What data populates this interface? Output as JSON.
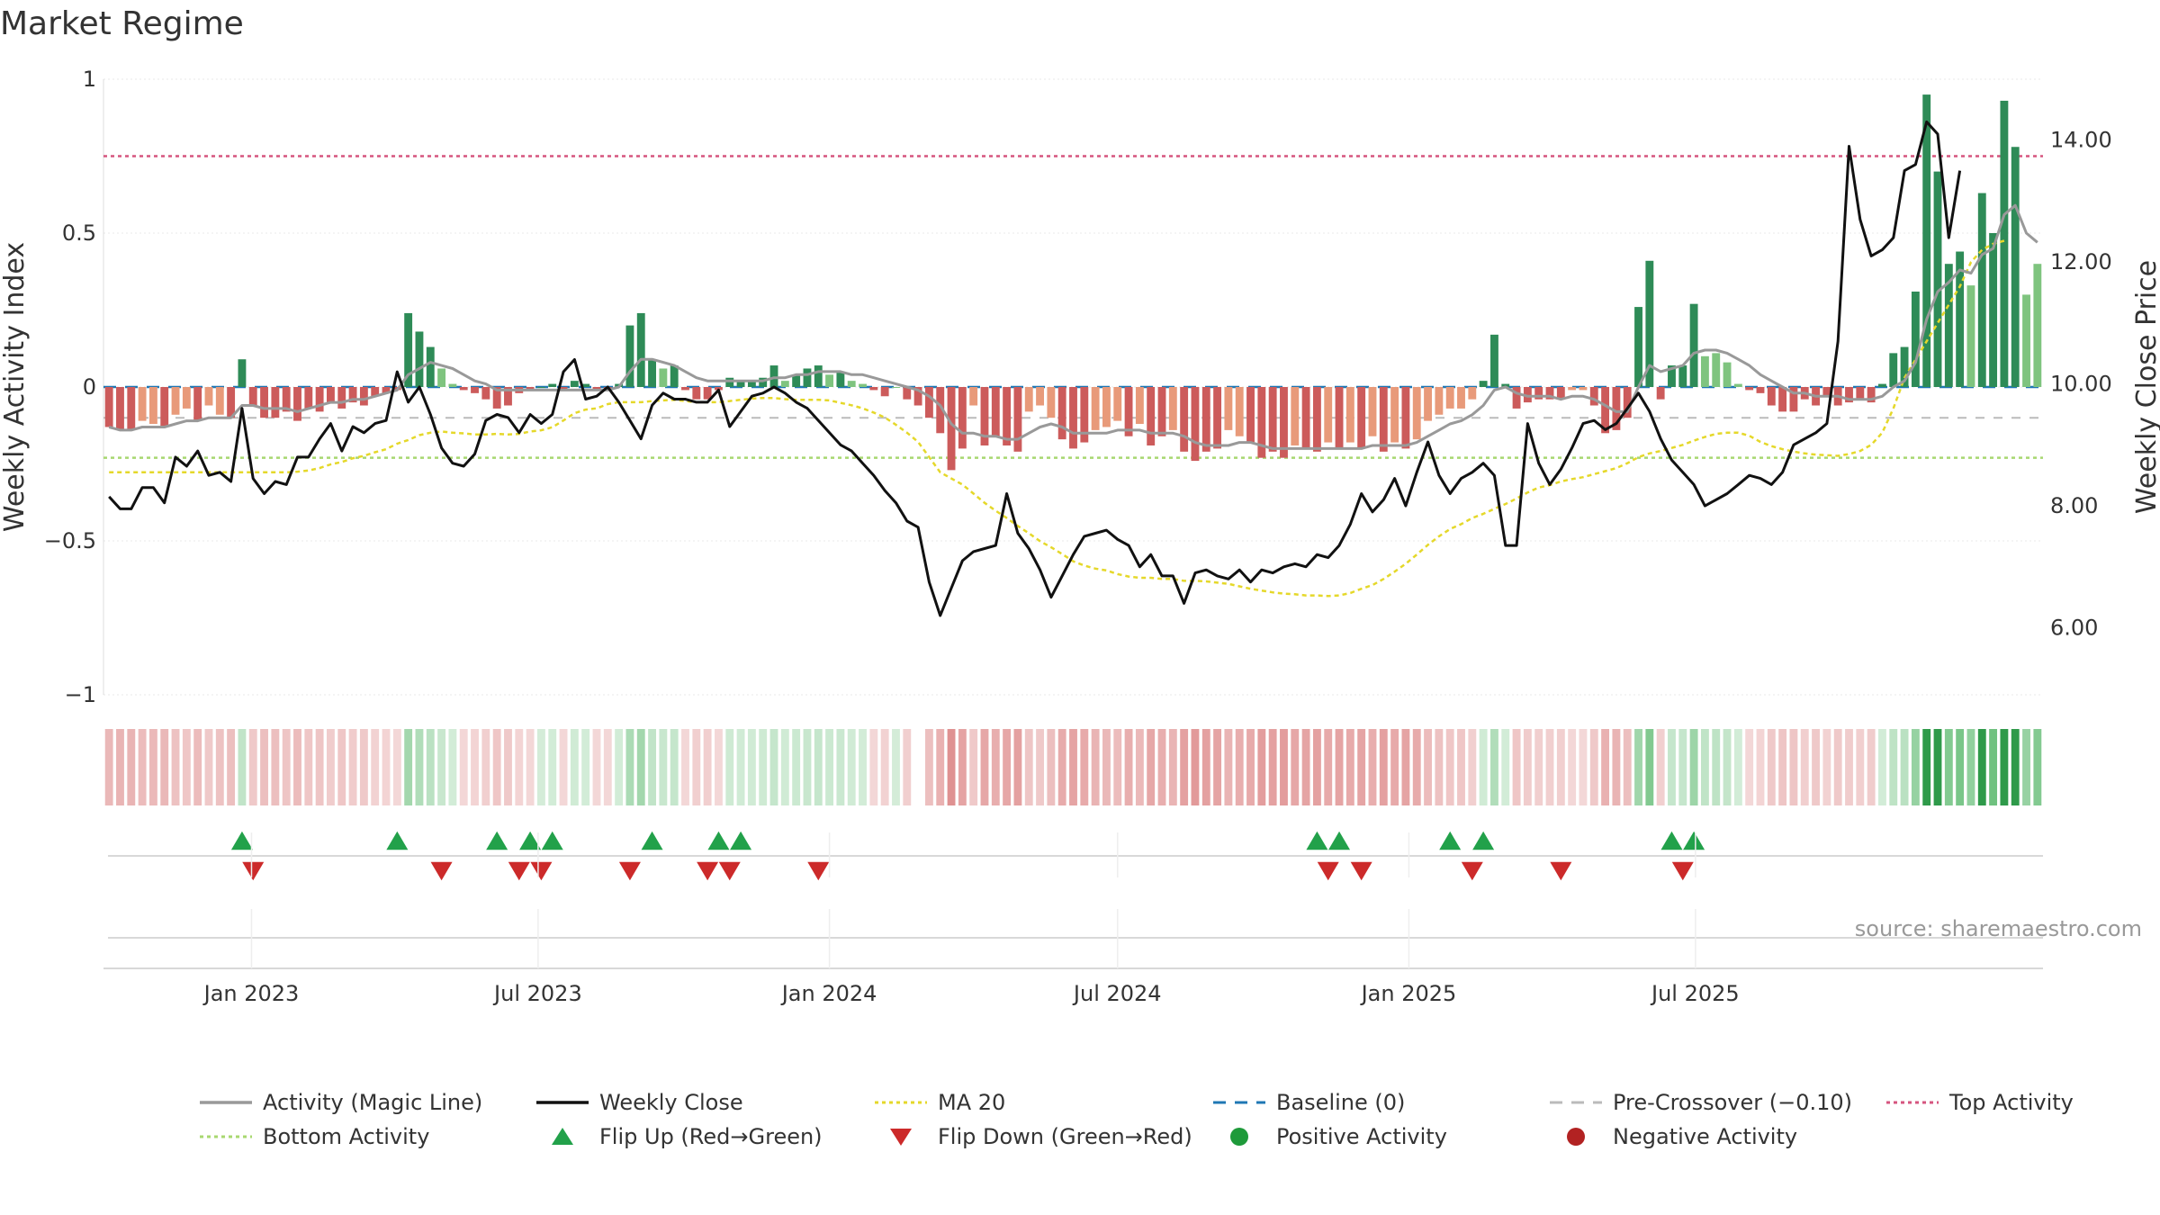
{
  "colors": {
    "bar_neg_strong": "#cc5b5b",
    "bar_neg_weak": "#e89a7a",
    "bar_pos_strong": "#2e8b57",
    "bar_pos_weak": "#7fc47f",
    "magic": "#999999",
    "close": "#111111",
    "ma20": "#e5d82a",
    "baseline": "#1f77b4",
    "precross": "#bbbbbb",
    "top": "#d6557f",
    "bottom": "#a8d870",
    "flip_up": "#22a14a",
    "flip_down": "#cc2a2a",
    "pos_dot": "#1e9a3a",
    "neg_dot": "#b22222"
  },
  "chart_data": {
    "type": "bar+line",
    "title": "Market Regime",
    "ylabel_left": "Weekly Activity Index",
    "ylabel_right": "Weekly Close Price",
    "y_left_ticks": [
      {
        "v": 1,
        "label": "1"
      },
      {
        "v": 0.5,
        "label": "0.5"
      },
      {
        "v": 0,
        "label": "0"
      },
      {
        "v": -0.5,
        "label": "−0.5"
      },
      {
        "v": -1,
        "label": "−1"
      }
    ],
    "y_left_range": [
      -1.0,
      1.0
    ],
    "y_right_ticks": [
      {
        "v": 14,
        "label": "14.00"
      },
      {
        "v": 12,
        "label": "12.00"
      },
      {
        "v": 10,
        "label": "10.00"
      },
      {
        "v": 8,
        "label": "8.00"
      },
      {
        "v": 6,
        "label": "6.00"
      }
    ],
    "y_right_range": [
      4.9,
      15.0
    ],
    "x_ticks": [
      "Jan 2023",
      "Jul 2023",
      "Jan 2024",
      "Jul 2024",
      "Jan 2025",
      "Jul 2025"
    ],
    "start_date": "2022-10-03",
    "reference_lines": {
      "baseline": 0,
      "precross": -0.1,
      "top": 0.75,
      "bottom": -0.23
    },
    "activity": [
      -0.13,
      -0.14,
      -0.14,
      -0.11,
      -0.12,
      -0.13,
      -0.09,
      -0.07,
      -0.11,
      -0.06,
      -0.09,
      -0.1,
      0.09,
      -0.06,
      -0.1,
      -0.1,
      -0.08,
      -0.11,
      -0.07,
      -0.08,
      -0.05,
      -0.07,
      -0.05,
      -0.06,
      -0.03,
      -0.02,
      -0.01,
      0.24,
      0.18,
      0.13,
      0.06,
      0.01,
      -0.01,
      -0.02,
      -0.04,
      -0.07,
      -0.06,
      -0.02,
      -0.01,
      0,
      0.01,
      -0.01,
      0.02,
      0.01,
      -0.01,
      -0.01,
      0.01,
      0.2,
      0.24,
      0.09,
      0.06,
      0.07,
      -0.01,
      -0.04,
      -0.04,
      -0.01,
      0.03,
      0.02,
      0.02,
      0.03,
      0.07,
      0.02,
      0.04,
      0.06,
      0.07,
      0.04,
      0.05,
      0.02,
      0.01,
      -0.01,
      -0.03,
      0,
      -0.04,
      -0.06,
      -0.1,
      -0.15,
      -0.27,
      -0.2,
      -0.06,
      -0.19,
      -0.16,
      -0.19,
      -0.21,
      -0.08,
      -0.06,
      -0.1,
      -0.17,
      -0.2,
      -0.18,
      -0.14,
      -0.13,
      -0.11,
      -0.16,
      -0.12,
      -0.19,
      -0.16,
      -0.14,
      -0.21,
      -0.24,
      -0.21,
      -0.2,
      -0.14,
      -0.16,
      -0.18,
      -0.23,
      -0.21,
      -0.23,
      -0.19,
      -0.2,
      -0.21,
      -0.18,
      -0.2,
      -0.18,
      -0.2,
      -0.16,
      -0.21,
      -0.18,
      -0.2,
      -0.17,
      -0.11,
      -0.09,
      -0.07,
      -0.07,
      -0.04,
      0.02,
      0.17,
      0.01,
      -0.07,
      -0.05,
      -0.04,
      -0.04,
      -0.04,
      -0.01,
      -0.01,
      -0.06,
      -0.15,
      -0.14,
      -0.1,
      0.26,
      0.41,
      -0.04,
      0.07,
      0.07,
      0.27,
      0.1,
      0.11,
      0.08,
      0.01,
      -0.01,
      -0.02,
      -0.06,
      -0.08,
      -0.08,
      -0.04,
      -0.06,
      -0.03,
      -0.06,
      -0.05,
      -0.04,
      -0.05,
      0.01,
      0.11,
      0.13,
      0.31,
      0.95,
      0.7,
      0.4,
      0.44,
      0.33,
      0.63,
      0.5,
      0.93,
      0.78,
      0.3,
      0.4
    ],
    "magic_line": [
      -0.13,
      -0.14,
      -0.14,
      -0.13,
      -0.13,
      -0.13,
      -0.12,
      -0.11,
      -0.11,
      -0.1,
      -0.1,
      -0.1,
      -0.06,
      -0.06,
      -0.07,
      -0.07,
      -0.07,
      -0.08,
      -0.07,
      -0.06,
      -0.05,
      -0.05,
      -0.04,
      -0.04,
      -0.03,
      -0.02,
      -0.01,
      0.04,
      0.06,
      0.08,
      0.07,
      0.06,
      0.04,
      0.02,
      0.01,
      -0.01,
      -0.01,
      -0.01,
      -0.01,
      -0.01,
      -0.01,
      -0.01,
      -0.01,
      -0.01,
      -0.01,
      -0.01,
      0,
      0.05,
      0.09,
      0.09,
      0.08,
      0.07,
      0.05,
      0.03,
      0.02,
      0.02,
      0.02,
      0.02,
      0.02,
      0.02,
      0.03,
      0.03,
      0.04,
      0.04,
      0.05,
      0.05,
      0.05,
      0.04,
      0.04,
      0.03,
      0.02,
      0.01,
      0,
      -0.01,
      -0.03,
      -0.06,
      -0.12,
      -0.15,
      -0.15,
      -0.16,
      -0.16,
      -0.17,
      -0.17,
      -0.15,
      -0.13,
      -0.12,
      -0.13,
      -0.15,
      -0.15,
      -0.15,
      -0.15,
      -0.14,
      -0.14,
      -0.14,
      -0.15,
      -0.15,
      -0.15,
      -0.16,
      -0.18,
      -0.19,
      -0.19,
      -0.19,
      -0.18,
      -0.18,
      -0.19,
      -0.2,
      -0.2,
      -0.2,
      -0.2,
      -0.2,
      -0.2,
      -0.2,
      -0.2,
      -0.2,
      -0.19,
      -0.19,
      -0.19,
      -0.19,
      -0.18,
      -0.16,
      -0.14,
      -0.12,
      -0.11,
      -0.09,
      -0.06,
      -0.01,
      0,
      -0.02,
      -0.03,
      -0.03,
      -0.03,
      -0.04,
      -0.03,
      -0.03,
      -0.04,
      -0.06,
      -0.08,
      -0.08,
      0,
      0.07,
      0.05,
      0.06,
      0.07,
      0.11,
      0.12,
      0.12,
      0.11,
      0.09,
      0.07,
      0.04,
      0.02,
      0,
      -0.02,
      -0.02,
      -0.03,
      -0.03,
      -0.03,
      -0.04,
      -0.04,
      -0.04,
      -0.03,
      0,
      0.02,
      0.08,
      0.22,
      0.31,
      0.34,
      0.38,
      0.37,
      0.43,
      0.45,
      0.56,
      0.59,
      0.5,
      0.47
    ],
    "weekly_close": [
      8.15,
      7.95,
      7.95,
      8.3,
      8.3,
      8.05,
      8.8,
      8.65,
      8.9,
      8.5,
      8.55,
      8.4,
      9.6,
      8.45,
      8.2,
      8.4,
      8.35,
      8.8,
      8.8,
      9.1,
      9.35,
      8.9,
      9.3,
      9.2,
      9.35,
      9.4,
      10.2,
      9.7,
      9.95,
      9.5,
      8.95,
      8.7,
      8.65,
      8.85,
      9.4,
      9.5,
      9.45,
      9.2,
      9.5,
      9.35,
      9.5,
      10.2,
      10.4,
      9.75,
      9.8,
      9.95,
      9.7,
      9.4,
      9.1,
      9.65,
      9.85,
      9.75,
      9.75,
      9.7,
      9.7,
      9.9,
      9.3,
      9.55,
      9.8,
      9.85,
      9.95,
      9.85,
      9.7,
      9.6,
      9.4,
      9.2,
      9.0,
      8.9,
      8.7,
      8.5,
      8.25,
      8.05,
      7.75,
      7.65,
      6.75,
      6.2,
      6.65,
      7.1,
      7.25,
      7.3,
      7.35,
      8.2,
      7.55,
      7.3,
      6.95,
      6.5,
      6.85,
      7.2,
      7.5,
      7.55,
      7.6,
      7.45,
      7.35,
      7.0,
      7.2,
      6.85,
      6.85,
      6.4,
      6.9,
      6.95,
      6.85,
      6.8,
      6.95,
      6.75,
      6.95,
      6.9,
      7.0,
      7.05,
      7.0,
      7.2,
      7.15,
      7.35,
      7.7,
      8.2,
      7.9,
      8.1,
      8.45,
      8.0,
      8.55,
      9.05,
      8.5,
      8.2,
      8.45,
      8.55,
      8.7,
      8.5,
      7.35,
      7.35,
      9.35,
      8.7,
      8.35,
      8.6,
      8.95,
      9.35,
      9.4,
      9.25,
      9.35,
      9.6,
      9.85,
      9.55,
      9.1,
      8.75,
      8.55,
      8.35,
      8.0,
      8.1,
      8.2,
      8.35,
      8.5,
      8.45,
      8.35,
      8.55,
      9.0,
      9.1,
      9.2,
      9.35,
      10.7,
      13.9,
      12.7,
      12.1,
      12.2,
      12.4,
      13.5,
      13.6,
      14.3,
      14.1,
      12.4,
      13.5
    ],
    "ma20": [
      8.55,
      8.55,
      8.55,
      8.55,
      8.55,
      8.55,
      8.55,
      8.55,
      8.55,
      8.55,
      8.55,
      8.55,
      8.55,
      8.55,
      8.55,
      8.55,
      8.55,
      8.56,
      8.58,
      8.62,
      8.68,
      8.72,
      8.78,
      8.82,
      8.88,
      8.93,
      9.02,
      9.08,
      9.16,
      9.2,
      9.22,
      9.2,
      9.19,
      9.17,
      9.17,
      9.18,
      9.17,
      9.18,
      9.22,
      9.24,
      9.29,
      9.4,
      9.52,
      9.58,
      9.6,
      9.67,
      9.7,
      9.7,
      9.7,
      9.72,
      9.73,
      9.74,
      9.72,
      9.7,
      9.7,
      9.7,
      9.72,
      9.74,
      9.76,
      9.77,
      9.77,
      9.75,
      9.74,
      9.74,
      9.74,
      9.73,
      9.69,
      9.65,
      9.6,
      9.53,
      9.45,
      9.33,
      9.2,
      9.05,
      8.8,
      8.55,
      8.45,
      8.35,
      8.2,
      8.05,
      7.92,
      7.8,
      7.67,
      7.55,
      7.42,
      7.32,
      7.21,
      7.09,
      7.02,
      6.97,
      6.94,
      6.88,
      6.84,
      6.82,
      6.82,
      6.8,
      6.8,
      6.77,
      6.77,
      6.76,
      6.74,
      6.72,
      6.68,
      6.64,
      6.61,
      6.58,
      6.56,
      6.55,
      6.53,
      6.53,
      6.52,
      6.53,
      6.57,
      6.64,
      6.7,
      6.8,
      6.92,
      7.05,
      7.2,
      7.36,
      7.5,
      7.62,
      7.7,
      7.8,
      7.87,
      7.95,
      8.03,
      8.12,
      8.22,
      8.3,
      8.34,
      8.4,
      8.44,
      8.47,
      8.52,
      8.57,
      8.62,
      8.7,
      8.8,
      8.86,
      8.9,
      8.95,
      9.0,
      9.07,
      9.13,
      9.18,
      9.2,
      9.2,
      9.15,
      9.05,
      8.98,
      8.93,
      8.89,
      8.86,
      8.84,
      8.83,
      8.82,
      8.85,
      8.9,
      9.0,
      9.2,
      9.6,
      10.1,
      10.4,
      10.7,
      11.0,
      11.3,
      11.6,
      12.0,
      12.2,
      12.3,
      12.35
    ],
    "regime_strip_gap_week": 73,
    "flip_up_weeks": [
      12,
      26,
      35,
      38,
      40,
      49,
      55,
      57,
      109,
      111,
      121,
      124,
      141,
      143
    ],
    "flip_down_weeks": [
      13,
      30,
      37,
      39,
      47,
      54,
      56,
      64,
      110,
      113,
      123,
      131,
      142
    ],
    "source": "source: sharemaestro.com"
  },
  "legend": [
    {
      "key": "magic",
      "label": "Activity (Magic Line)",
      "style": "line"
    },
    {
      "key": "close",
      "label": "Weekly Close",
      "style": "line"
    },
    {
      "key": "ma20",
      "label": "MA 20",
      "style": "dotted"
    },
    {
      "key": "baseline",
      "label": "Baseline (0)",
      "style": "dashed"
    },
    {
      "key": "precross",
      "label": "Pre-Crossover (−0.10)",
      "style": "dashed"
    },
    {
      "key": "top",
      "label": "Top Activity",
      "style": "dotted"
    },
    {
      "key": "bottom",
      "label": "Bottom Activity",
      "style": "dotted"
    },
    {
      "key": "flip_up",
      "label": "Flip Up (Red→Green)",
      "style": "tri-up"
    },
    {
      "key": "flip_down",
      "label": "Flip Down (Green→Red)",
      "style": "tri-down"
    },
    {
      "key": "pos_dot",
      "label": "Positive Activity",
      "style": "dot"
    },
    {
      "key": "neg_dot",
      "label": "Negative Activity",
      "style": "dot"
    }
  ]
}
